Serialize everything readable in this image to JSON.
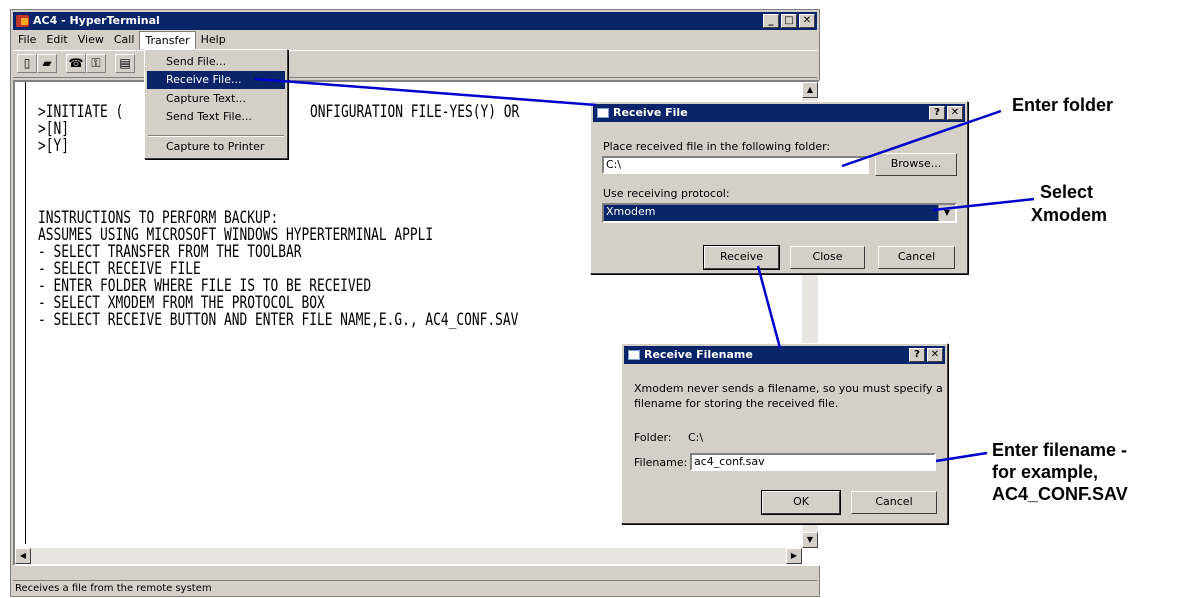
{
  "window": {
    "title": "AC4 - HyperTerminal",
    "controls": [
      "minimize",
      "maximize",
      "close"
    ]
  },
  "menubar": [
    "File",
    "Edit",
    "View",
    "Call",
    "Transfer",
    "Help"
  ],
  "toolbar_icons": [
    "new-icon",
    "open-icon",
    "disconnect-icon",
    "dial-icon",
    "properties-icon"
  ],
  "transfer_menu": {
    "items": [
      "Send File...",
      "Receive File...",
      "Capture Text...",
      "Send Text File...",
      "Capture to Printer"
    ],
    "highlighted": "Receive File..."
  },
  "terminal": {
    "lines": [
      ">INITIATE (",
      ">[N]",
      ">[Y]",
      "INSTRUCTIONS TO PERFORM BACKUP:",
      "ASSUMES USING MICROSOFT WINDOWS HYPERTERMINAL APPLI",
      "- SELECT TRANSFER FROM THE TOOLBAR",
      "- SELECT RECEIVE FILE",
      "- ENTER FOLDER WHERE FILE IS TO BE RECEIVED",
      "- SELECT XMODEM FROM THE PROTOCOL BOX",
      "- SELECT RECEIVE BUTTON AND ENTER FILE NAME,E.G., AC4_CONF.SAV"
    ],
    "partial": "ONFIGURATION FILE-YES(Y) OR"
  },
  "statusbar": "Receives a file from the remote system",
  "receive_file_dialog": {
    "title": "Receive File",
    "folder_label": "Place received file in the following folder:",
    "folder_value": "C:\\",
    "browse_label": "Browse...",
    "protocol_label": "Use receiving protocol:",
    "protocol_value": "Xmodem",
    "receive_label": "Receive",
    "close_label": "Close",
    "cancel_label": "Cancel"
  },
  "receive_filename_dialog": {
    "title": "Receive Filename",
    "message_line1": "Xmodem never sends a filename, so you must specify a",
    "message_line2": "filename for storing the received file.",
    "folder_label": "Folder:",
    "folder_value": "C:\\",
    "filename_label": "Filename:",
    "filename_value": "ac4_conf.sav",
    "ok_label": "OK",
    "cancel_label": "Cancel"
  },
  "callouts": {
    "enter_folder": "Enter folder",
    "select_xmodem_1": "Select",
    "select_xmodem_2": "Xmodem",
    "enter_filename_1": "Enter filename -",
    "enter_filename_2": "for example,",
    "enter_filename_3": "AC4_CONF.SAV"
  },
  "colors": {
    "titlebar": "#0a246a",
    "window_face": "#d4d0c8",
    "callout_line": "#0000cc"
  }
}
